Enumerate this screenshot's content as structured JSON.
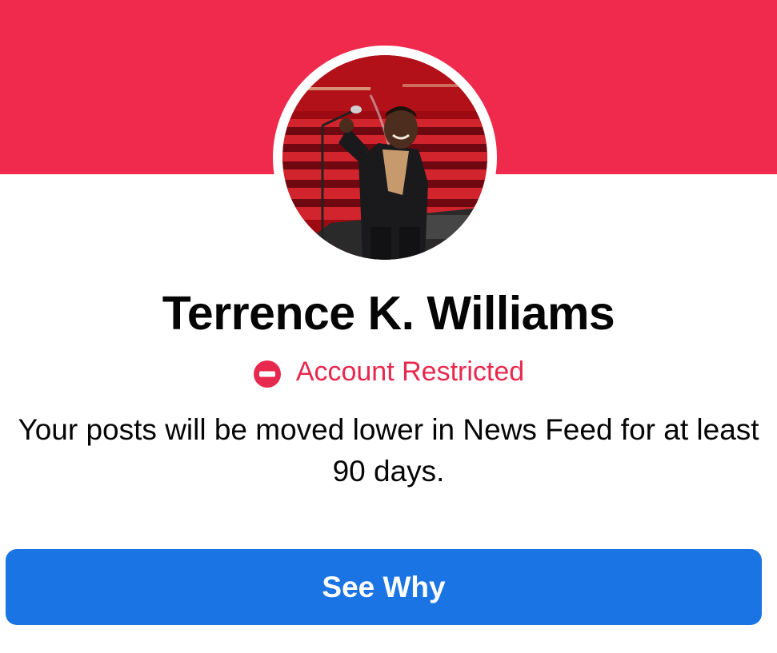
{
  "profile": {
    "name": "Terrence K. Williams",
    "avatar": "profile-photo-performer-with-microphone-in-red-theater"
  },
  "status": {
    "icon": "restricted-icon",
    "label": "Account Restricted"
  },
  "message": "Your posts will be moved lower in News Feed for at least 90 days.",
  "actions": {
    "see_why_label": "See Why"
  },
  "colors": {
    "banner": "#ef2a4d",
    "status_red": "#e8294e",
    "button_blue": "#1b74e4",
    "text_dark": "#050505"
  }
}
